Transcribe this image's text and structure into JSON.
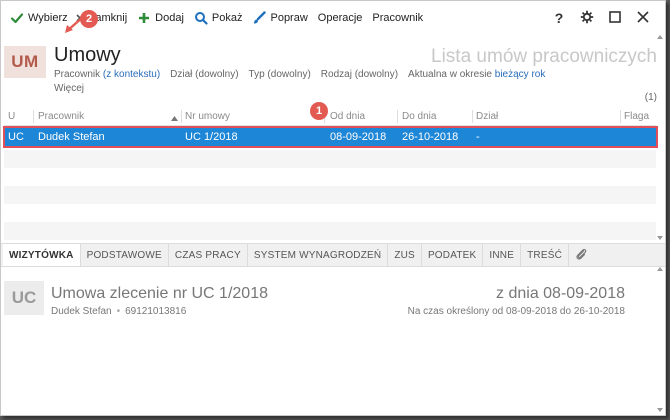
{
  "toolbar": {
    "select_label": "Wybierz",
    "close_label": "Zamknij",
    "add_label": "Dodaj",
    "show_label": "Pokaż",
    "edit_label": "Popraw",
    "operations_label": "Operacje",
    "employee_label": "Pracownik",
    "help_label": "?"
  },
  "header": {
    "logo": "UM",
    "title": "Umowy",
    "list_title": "Lista umów pracowniczych",
    "filters": {
      "employee": "Pracownik",
      "employee_value": "(z kontekstu)",
      "department": "Dział (dowolny)",
      "type": "Typ (dowolny)",
      "kind": "Rodzaj (dowolny)",
      "period": "Aktualna w okresie",
      "period_value": "bieżący rok"
    },
    "more": "Więcej",
    "count": "(1)"
  },
  "grid": {
    "columns": [
      "U",
      "Pracownik",
      "Nr umowy",
      "Od dnia",
      "Do dnia",
      "Dział",
      "Flaga"
    ],
    "rows": [
      {
        "u": "UC",
        "employee": "Dudek Stefan",
        "number": "UC 1/2018",
        "from": "08-09-2018",
        "to": "26-10-2018",
        "department": "-",
        "flag": ""
      }
    ]
  },
  "badges": {
    "one": "1",
    "two": "2"
  },
  "tabs": [
    "WIZYTÓWKA",
    "PODSTAWOWE",
    "CZAS PRACY",
    "SYSTEM WYNAGRODZEŃ",
    "ZUS",
    "PODATEK",
    "INNE",
    "TREŚĆ"
  ],
  "detail": {
    "logo": "UC",
    "title": "Umowa zlecenie nr UC 1/2018",
    "employee": "Dudek Stefan",
    "pesel": "69121013816",
    "date_label": "z dnia 08-09-2018",
    "range": "Na czas określony od 08-09-2018 do 26-10-2018"
  },
  "colors": {
    "selection": "#1e86d6",
    "highlight": "#e0505a",
    "badge": "#e25a52",
    "logo_bg": "#f1e1dc",
    "logo_text": "#b25b4b",
    "link": "#2a6ebb"
  }
}
